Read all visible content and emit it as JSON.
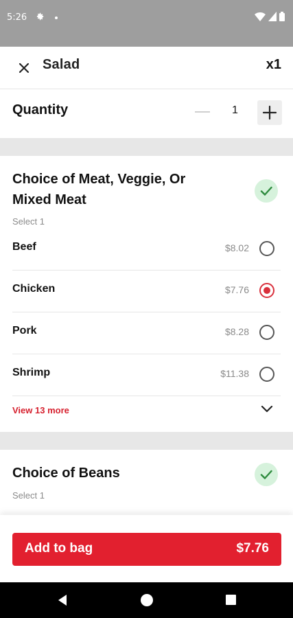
{
  "status_bar": {
    "time": "5:26",
    "icons": [
      "gear-icon",
      "dot",
      "wifi-icon",
      "signal-icon",
      "battery-icon"
    ]
  },
  "header": {
    "title": "Salad",
    "quantity_badge": "x1",
    "close_icon": "close-icon"
  },
  "quantity": {
    "label": "Quantity",
    "value": "1",
    "minus_icon": "minus-icon",
    "plus_icon": "plus-icon"
  },
  "sections": [
    {
      "title": "Choice of Meat, Veggie, Or Mixed Meat",
      "subtitle": "Select 1",
      "completed": true,
      "options": [
        {
          "name": "Beef",
          "price": "$8.02",
          "selected": false
        },
        {
          "name": "Chicken",
          "price": "$7.76",
          "selected": true
        },
        {
          "name": "Pork",
          "price": "$8.28",
          "selected": false
        },
        {
          "name": "Shrimp",
          "price": "$11.38",
          "selected": false
        }
      ],
      "view_more": "View 13 more"
    },
    {
      "title": "Choice of Beans",
      "subtitle": "Select 1",
      "completed": true
    }
  ],
  "footer": {
    "button_label": "Add to bag",
    "button_price": "$7.76"
  },
  "colors": {
    "accent": "#e2202f",
    "check_bg": "#d6f2dc",
    "check": "#2e8b3e",
    "divider": "#e7e7e7"
  }
}
